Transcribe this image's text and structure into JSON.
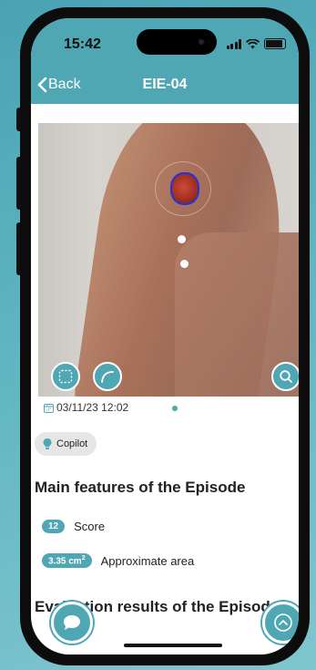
{
  "status_bar": {
    "time": "15:42"
  },
  "nav": {
    "back_label": "Back",
    "title": "EIE-04"
  },
  "photo": {
    "timestamp": "03/11/23 12:02",
    "pages": 1,
    "current_page": 1
  },
  "copilot": {
    "label": "Copilot"
  },
  "main_features": {
    "heading": "Main features of the Episode",
    "items": [
      {
        "badge": "12",
        "label": "Score"
      },
      {
        "badge": "3.35 cm",
        "badge_sup": "2",
        "label": "Approximate area"
      }
    ]
  },
  "evaluation": {
    "heading": "Evaluation results of the Episode"
  },
  "colors": {
    "accent": "#4fa7b4",
    "outline": "#1f35e0"
  },
  "icons": {
    "back": "chevron-left-icon",
    "select": "dashed-square-icon",
    "draw": "curve-icon",
    "zoom": "magnifier-icon",
    "calendar": "calendar-icon",
    "copilot": "lightbulb-icon",
    "chat": "chat-bubble-icon",
    "scroll_top": "chevron-up-icon"
  }
}
